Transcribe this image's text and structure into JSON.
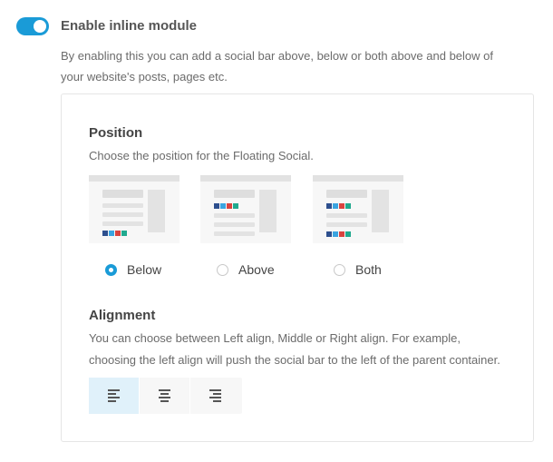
{
  "module": {
    "enabled": true,
    "title": "Enable inline module",
    "description": "By enabling this you can add a social bar above, below or both above and below of your website's posts, pages etc."
  },
  "position": {
    "title": "Position",
    "description": "Choose the position for the Floating Social.",
    "selected": "below",
    "options": [
      {
        "id": "below",
        "label": "Below"
      },
      {
        "id": "above",
        "label": "Above"
      },
      {
        "id": "both",
        "label": "Both"
      }
    ]
  },
  "alignment": {
    "title": "Alignment",
    "description": "You can choose between Left align, Middle or Right align. For example, choosing the left align will push the social bar to the left of the parent container.",
    "selected": "left",
    "options": [
      "left",
      "center",
      "right"
    ]
  },
  "colors": {
    "accent": "#1a9bd7",
    "social_squares": [
      "#2d4f8e",
      "#3aa4e0",
      "#d9433f",
      "#20a98e"
    ]
  }
}
